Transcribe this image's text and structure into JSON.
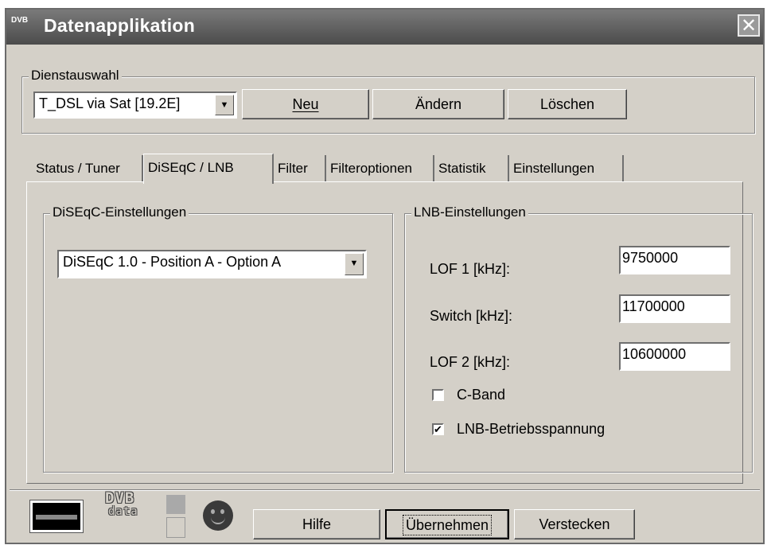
{
  "window": {
    "title": "Datenapplikation",
    "app_icon_text": "DVB",
    "close_label": "✕"
  },
  "service": {
    "group_label": "Dienstauswahl",
    "selected": "T_DSL via Sat [19.2E]",
    "buttons": {
      "new": "Neu",
      "edit": "Ändern",
      "delete": "Löschen"
    }
  },
  "tabs": [
    {
      "label": "Status / Tuner",
      "active": false
    },
    {
      "label": "DiSEqC / LNB",
      "active": true
    },
    {
      "label": "Filter",
      "active": false
    },
    {
      "label": "Filteroptionen",
      "active": false
    },
    {
      "label": "Statistik",
      "active": false
    },
    {
      "label": "Einstellungen",
      "active": false
    }
  ],
  "diseqc": {
    "group_label": "DiSEqC-Einstellungen",
    "selected": "DiSEqC 1.0 - Position A - Option A"
  },
  "lnb": {
    "group_label": "LNB-Einstellungen",
    "lof1_label": "LOF 1 [kHz]:",
    "lof1_value": "9750000",
    "switch_label": "Switch [kHz]:",
    "switch_value": "11700000",
    "lof2_label": "LOF 2 [kHz]:",
    "lof2_value": "10600000",
    "cband_label": "C-Band",
    "cband_checked": false,
    "voltage_label": "LNB-Betriebsspannung",
    "voltage_checked": true
  },
  "footer": {
    "logo_top": "DVB",
    "logo_bottom": "data",
    "buttons": {
      "help": "Hilfe",
      "apply": "Übernehmen",
      "hide": "Verstecken"
    }
  }
}
